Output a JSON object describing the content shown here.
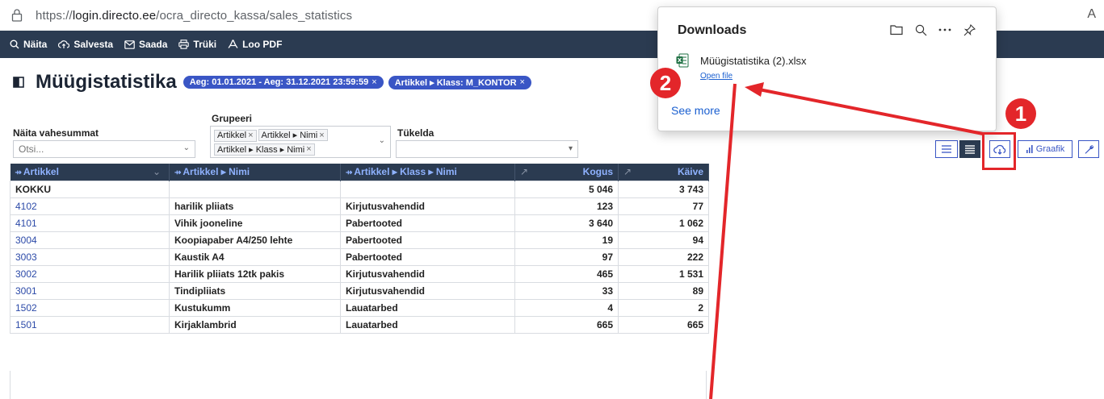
{
  "browser": {
    "url_prefix": "https://",
    "url_host": "login.directo.ee",
    "url_path": "/ocra_directo_kassa/sales_statistics",
    "right_letter": "A"
  },
  "toolbar": {
    "items": [
      {
        "label": "Näita",
        "icon": "search-icon"
      },
      {
        "label": "Salvesta",
        "icon": "cloud-upload-icon"
      },
      {
        "label": "Saada",
        "icon": "mail-icon"
      },
      {
        "label": "Trüki",
        "icon": "printer-icon"
      },
      {
        "label": "Loo PDF",
        "icon": "pdf-icon"
      }
    ]
  },
  "page": {
    "title": "Müügistatistika",
    "chips": [
      {
        "label": "Aeg: 01.01.2021 - Aeg: 31.12.2021 23:59:59",
        "close": "×"
      },
      {
        "label": "Artikkel ▸ Klass: M_KONTOR",
        "close": "×"
      }
    ]
  },
  "filters": {
    "subtotals_label": "Näita vahesummat",
    "subtotals_placeholder": "Otsi...",
    "group_label": "Grupeeri",
    "group_tags": [
      "Artikkel",
      "Artikkel ▸ Nimi",
      "Artikkel ▸ Klass ▸ Nimi"
    ],
    "split_label": "Tükelda",
    "split_value": ""
  },
  "right_buttons": {
    "graph_label": "Graafik"
  },
  "table": {
    "columns": [
      "Artikkel",
      "Artikkel ▸ Nimi",
      "Artikkel ▸ Klass ▸ Nimi",
      "Kogus",
      "Käive"
    ],
    "total": {
      "label": "KOKKU",
      "kogus": "5 046",
      "kaive": "3 743"
    },
    "rows": [
      {
        "code": "4102",
        "name": "harilik pliiats",
        "klass": "Kirjutusvahendid",
        "kogus": "123",
        "kaive": "77"
      },
      {
        "code": "4101",
        "name": "Vihik jooneline",
        "klass": "Pabertooted",
        "kogus": "3 640",
        "kaive": "1 062"
      },
      {
        "code": "3004",
        "name": "Koopiapaber A4/250 lehte",
        "klass": "Pabertooted",
        "kogus": "19",
        "kaive": "94"
      },
      {
        "code": "3003",
        "name": "Kaustik A4",
        "klass": "Pabertooted",
        "kogus": "97",
        "kaive": "222"
      },
      {
        "code": "3002",
        "name": "Harilik pliiats 12tk pakis",
        "klass": "Kirjutusvahendid",
        "kogus": "465",
        "kaive": "1 531"
      },
      {
        "code": "3001",
        "name": "Tindipliiats",
        "klass": "Kirjutusvahendid",
        "kogus": "33",
        "kaive": "89"
      },
      {
        "code": "1502",
        "name": "Kustukumm",
        "klass": "Lauatarbed",
        "kogus": "4",
        "kaive": "2"
      },
      {
        "code": "1501",
        "name": "Kirjaklambrid",
        "klass": "Lauatarbed",
        "kogus": "665",
        "kaive": "665"
      }
    ]
  },
  "downloads": {
    "title": "Downloads",
    "file_name": "Müügistatistika (2).xlsx",
    "open_file": "Open file",
    "see_more": "See more"
  },
  "annotations": {
    "badge1": "1",
    "badge2": "2",
    "color": "#e3262a"
  }
}
